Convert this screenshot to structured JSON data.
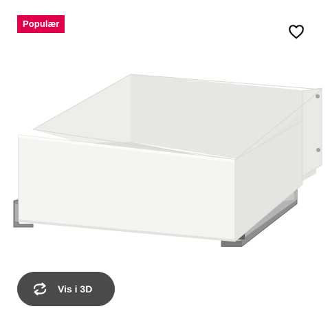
{
  "badge": {
    "label": "Populær",
    "color": "#e0004d"
  },
  "favourite": {
    "icon": "heart-outline-icon"
  },
  "product_image": {
    "subject": "white drawer on metal runners"
  },
  "view_3d": {
    "label": "Vis i 3D",
    "icon": "rotate-arrows-icon",
    "background": "#4a4a4a"
  }
}
